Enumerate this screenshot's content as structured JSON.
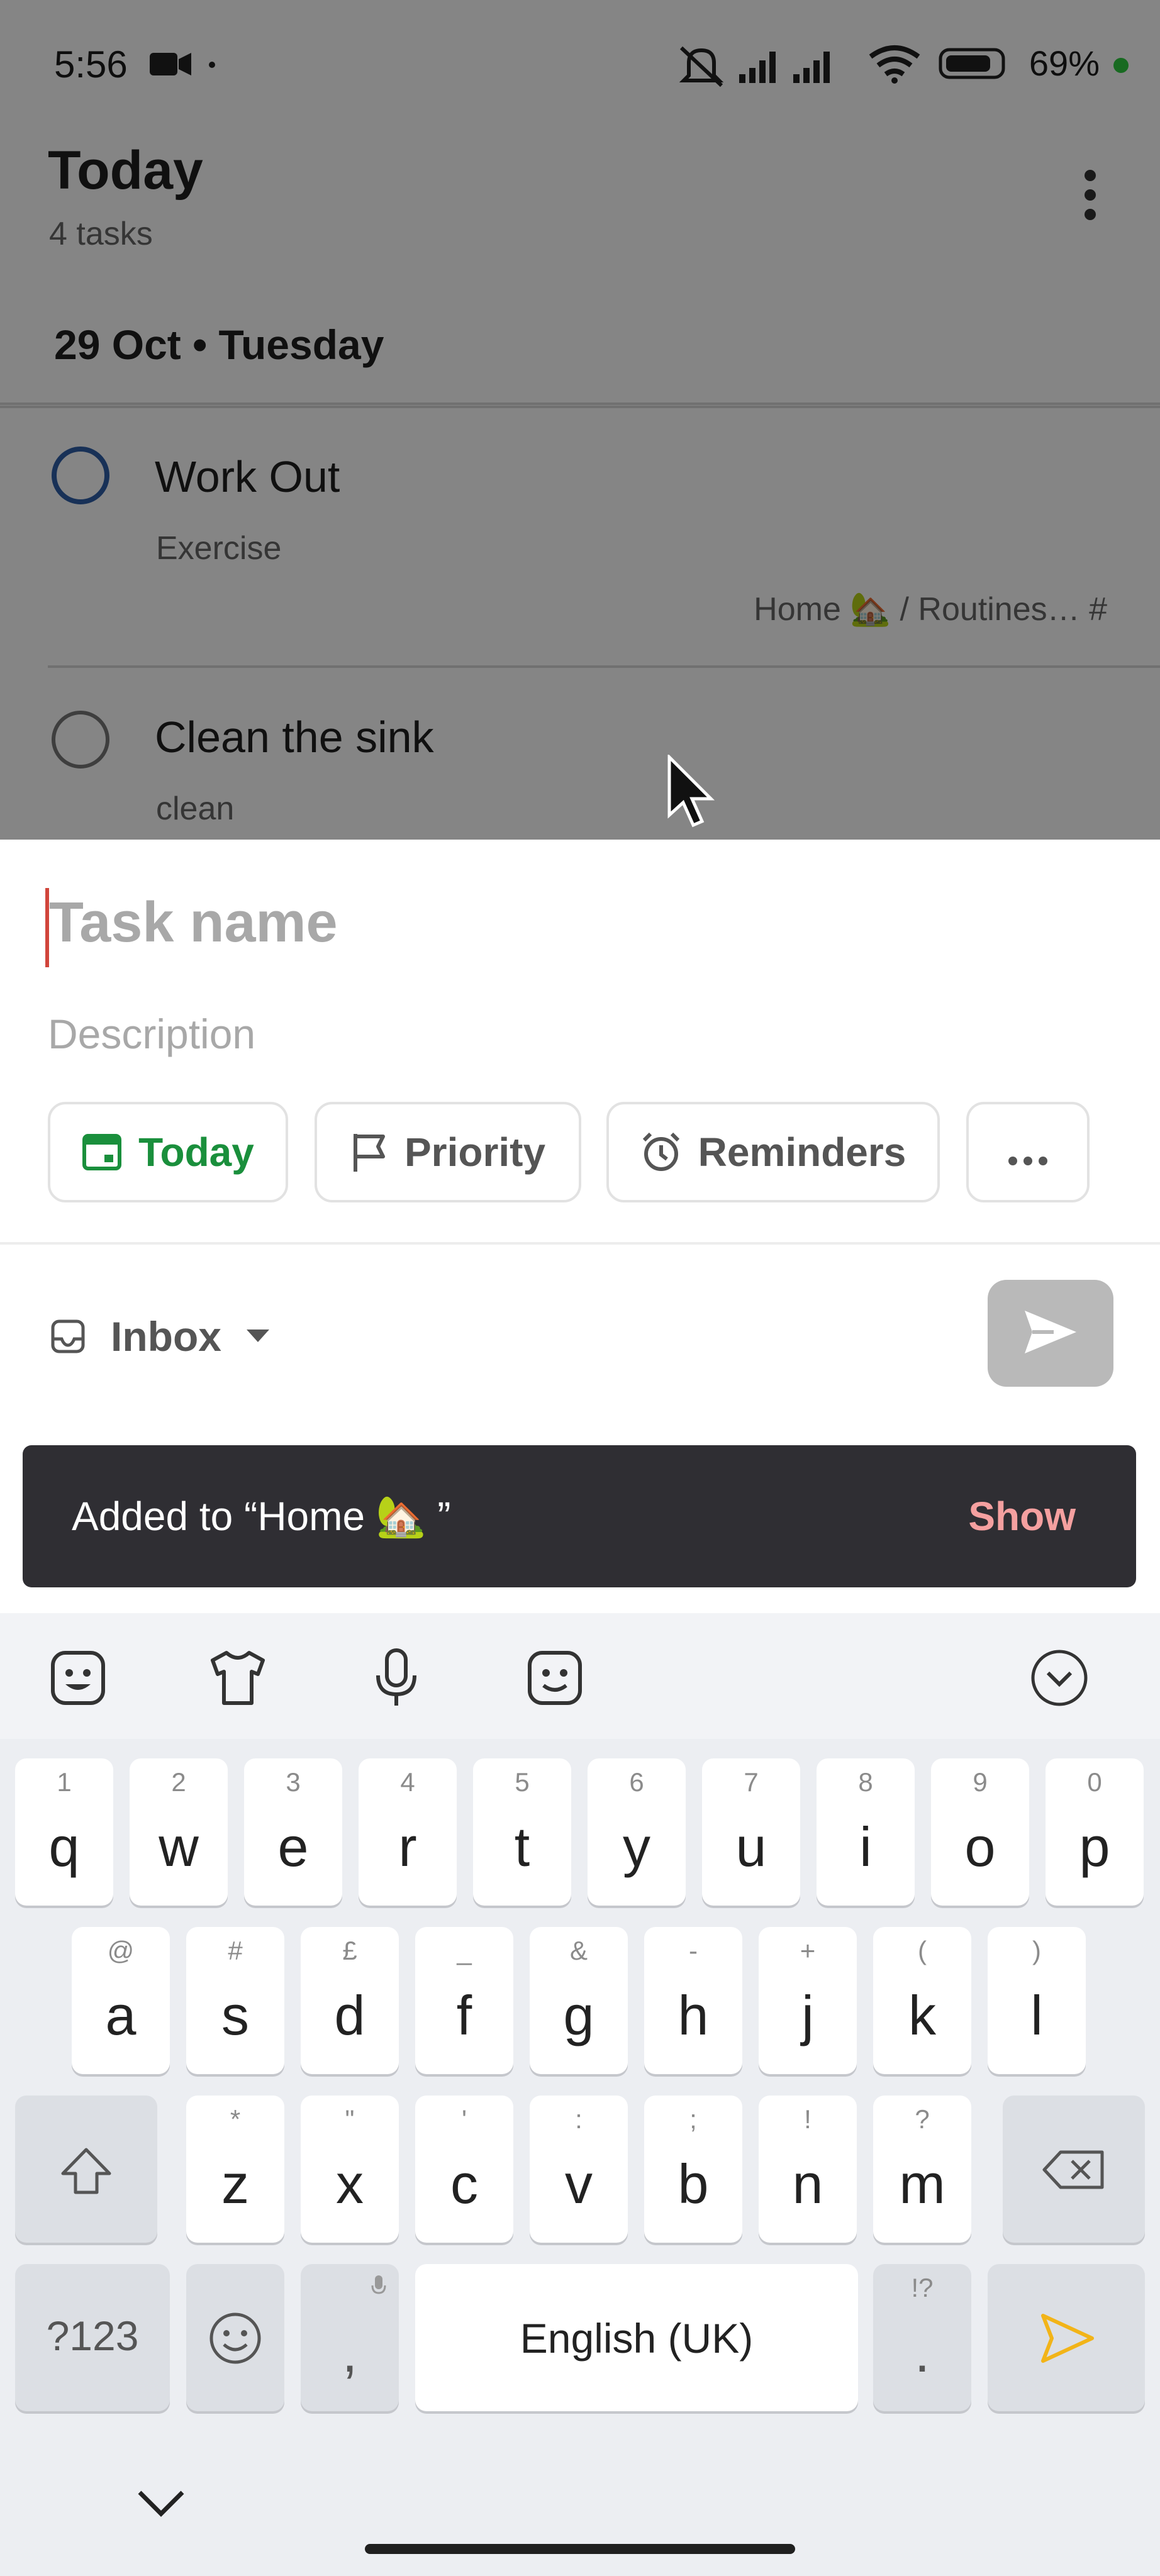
{
  "status_bar": {
    "time": "5:56",
    "battery": "69%"
  },
  "header": {
    "title": "Today",
    "subtitle": "4 tasks"
  },
  "date_section": "29 Oct • Tuesday",
  "tasks": [
    {
      "title": "Work Out",
      "description": "Exercise",
      "project": "Home 🏡 / Routines… #"
    },
    {
      "title": "Clean the sink",
      "description": "clean"
    }
  ],
  "composer": {
    "task_name_placeholder": "Task name",
    "description_placeholder": "Description",
    "chips": {
      "today": "Today",
      "priority": "Priority",
      "reminders": "Reminders"
    },
    "project": "Inbox"
  },
  "snackbar": {
    "message": "Added to “Home 🏡 ”",
    "action": "Show"
  },
  "keyboard": {
    "row1": [
      {
        "hint": "1",
        "key": "q"
      },
      {
        "hint": "2",
        "key": "w"
      },
      {
        "hint": "3",
        "key": "e"
      },
      {
        "hint": "4",
        "key": "r"
      },
      {
        "hint": "5",
        "key": "t"
      },
      {
        "hint": "6",
        "key": "y"
      },
      {
        "hint": "7",
        "key": "u"
      },
      {
        "hint": "8",
        "key": "i"
      },
      {
        "hint": "9",
        "key": "o"
      },
      {
        "hint": "0",
        "key": "p"
      }
    ],
    "row2": [
      {
        "hint": "@",
        "key": "a"
      },
      {
        "hint": "#",
        "key": "s"
      },
      {
        "hint": "£",
        "key": "d"
      },
      {
        "hint": "_",
        "key": "f"
      },
      {
        "hint": "&",
        "key": "g"
      },
      {
        "hint": "-",
        "key": "h"
      },
      {
        "hint": "+",
        "key": "j"
      },
      {
        "hint": "(",
        "key": "k"
      },
      {
        "hint": ")",
        "key": "l"
      }
    ],
    "row3": [
      {
        "hint": "*",
        "key": "z"
      },
      {
        "hint": "\"",
        "key": "x"
      },
      {
        "hint": "'",
        "key": "c"
      },
      {
        "hint": ":",
        "key": "v"
      },
      {
        "hint": ";",
        "key": "b"
      },
      {
        "hint": "!",
        "key": "n"
      },
      {
        "hint": "?",
        "key": "m"
      }
    ],
    "symbols_label": "?123",
    "comma": ",",
    "space_label": "English (UK)",
    "period_hint": "!?",
    "period": "."
  },
  "colors": {
    "accent_green": "#1a8f3c",
    "snackbar_action": "#f5a0a0",
    "task_circle_blue": "#2f5ea8"
  }
}
